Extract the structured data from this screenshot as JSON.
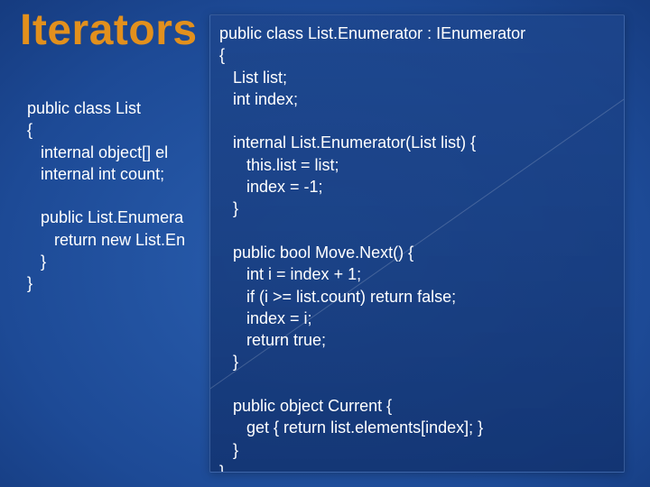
{
  "title": "Iterators",
  "code_left": "public class List\n{\n   internal object[] el\n   internal int count;\n\n   public List.Enumera\n      return new List.En\n   }\n}",
  "code_right": "public class List.Enumerator : IEnumerator\n{\n   List list;\n   int index;\n\n   internal List.Enumerator(List list) {\n      this.list = list;\n      index = -1;\n   }\n\n   public bool Move.Next() {\n      int i = index + 1;\n      if (i >= list.count) return false;\n      index = i;\n      return true;\n   }\n\n   public object Current {\n      get { return list.elements[index]; }\n   }\n}"
}
